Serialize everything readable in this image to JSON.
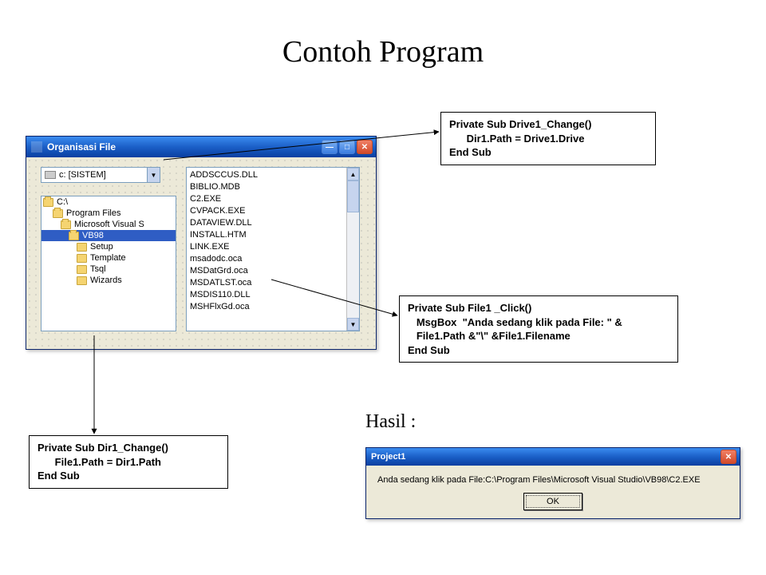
{
  "pageTitle": "Contoh Program",
  "vbWindow": {
    "title": "Organisasi File",
    "driveText": "c: [SISTEM]",
    "dirs": [
      {
        "label": "C:\\",
        "indent": 0,
        "open": true,
        "selected": false
      },
      {
        "label": "Program Files",
        "indent": 1,
        "open": true,
        "selected": false
      },
      {
        "label": "Microsoft Visual S",
        "indent": 2,
        "open": true,
        "selected": false
      },
      {
        "label": "VB98",
        "indent": 3,
        "open": true,
        "selected": true
      },
      {
        "label": "Setup",
        "indent": 4,
        "open": false,
        "selected": false
      },
      {
        "label": "Template",
        "indent": 4,
        "open": false,
        "selected": false
      },
      {
        "label": "Tsql",
        "indent": 4,
        "open": false,
        "selected": false
      },
      {
        "label": "Wizards",
        "indent": 4,
        "open": false,
        "selected": false
      }
    ],
    "files": [
      "ADDSCCUS.DLL",
      "BIBLIO.MDB",
      "C2.EXE",
      "CVPACK.EXE",
      "DATAVIEW.DLL",
      "INSTALL.HTM",
      "LINK.EXE",
      "msadodc.oca",
      "MSDatGrd.oca",
      "MSDATLST.oca",
      "MSDIS110.DLL",
      "MSHFlxGd.oca"
    ]
  },
  "code1": "Private Sub Drive1_Change()\n      Dir1.Path = Drive1.Drive\nEnd Sub",
  "code2": "Private Sub File1 _Click()\n   MsgBox  \"Anda sedang klik pada File: \" &\n   File1.Path &\"\\\" &File1.Filename\nEnd Sub",
  "code3": "Private Sub Dir1_Change()\n      File1.Path = Dir1.Path\nEnd Sub",
  "hasilLabel": "Hasil :",
  "msgbox": {
    "title": "Project1",
    "body": "Anda sedang klik pada File:C:\\Program Files\\Microsoft Visual Studio\\VB98\\C2.EXE",
    "okLabel": "OK"
  },
  "glyphs": {
    "min": "—",
    "max": "□",
    "close": "✕",
    "down": "▼",
    "up": "▲"
  }
}
